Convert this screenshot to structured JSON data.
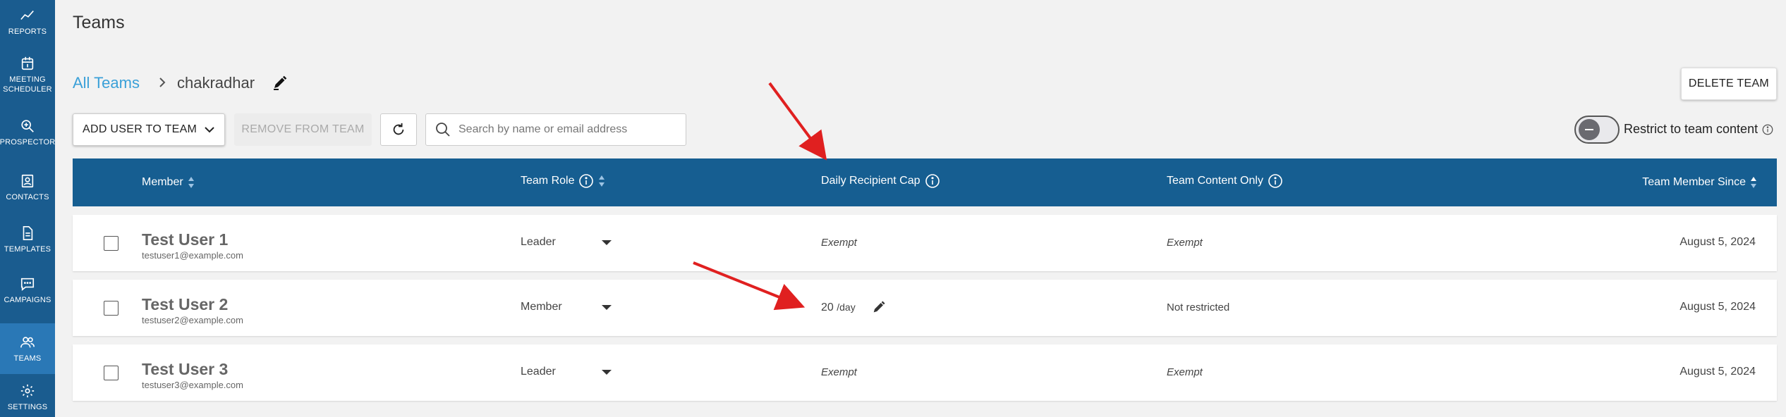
{
  "sidebar": {
    "items": [
      {
        "label": "REPORTS",
        "icon": "chart-line-icon"
      },
      {
        "label": "MEETING SCHEDULER",
        "icon": "calendar-icon"
      },
      {
        "label": "PROSPECTOR",
        "icon": "search-plus-icon"
      },
      {
        "label": "CONTACTS",
        "icon": "contact-card-icon"
      },
      {
        "label": "TEMPLATES",
        "icon": "document-icon"
      },
      {
        "label": "CAMPAIGNS",
        "icon": "chat-bubble-icon"
      },
      {
        "label": "TEAMS",
        "icon": "people-icon",
        "active": true
      },
      {
        "label": "SETTINGS",
        "icon": "gear-icon"
      }
    ]
  },
  "page": {
    "title": "Teams"
  },
  "breadcrumb": {
    "root": "All Teams",
    "current": "chakradhar"
  },
  "toolbar": {
    "add_user": "ADD USER TO TEAM",
    "remove": "REMOVE FROM TEAM",
    "delete_team": "DELETE TEAM",
    "search_placeholder": "Search by name or email address",
    "restrict_label": "Restrict to team content",
    "restrict_enabled": false
  },
  "table": {
    "headers": {
      "member": "Member",
      "team_role": "Team Role",
      "daily_cap": "Daily Recipient Cap",
      "content_only": "Team Content Only",
      "member_since": "Team Member Since"
    },
    "rows": [
      {
        "name": "Test User 1",
        "email": "testuser1@example.com",
        "role": "Leader",
        "cap": "Exempt",
        "content_only": "Exempt",
        "since": "August 5, 2024"
      },
      {
        "name": "Test User 2",
        "email": "testuser2@example.com",
        "role": "Member",
        "cap": "20",
        "cap_unit": "/day",
        "content_only": "Not restricted",
        "since": "August 5, 2024"
      },
      {
        "name": "Test User 3",
        "email": "testuser3@example.com",
        "role": "Leader",
        "cap": "Exempt",
        "content_only": "Exempt",
        "since": "August 5, 2024"
      }
    ]
  },
  "colors": {
    "sidebar": "#1a5c8f",
    "sidebar_active": "#2a78b6",
    "table_header": "#165e91",
    "link": "#3aa0d8",
    "annotation_arrow": "#e02020"
  }
}
